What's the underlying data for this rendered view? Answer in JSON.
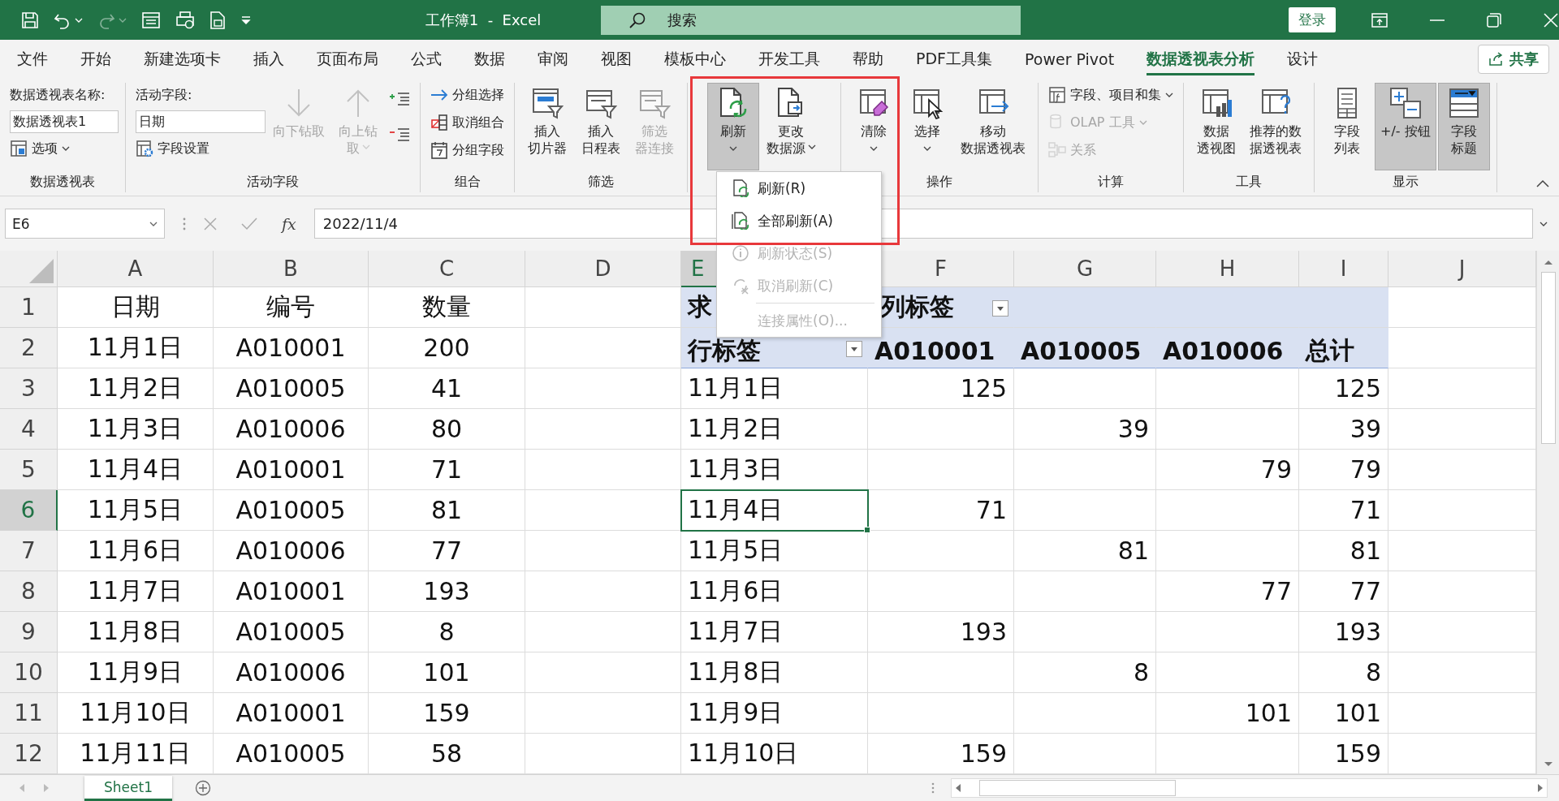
{
  "title_bar": {
    "title": "工作簿1  -  Excel",
    "search": {
      "placeholder": "搜索"
    },
    "login_button": "登录"
  },
  "tabs": [
    {
      "label": "文件",
      "selected": false
    },
    {
      "label": "开始",
      "selected": false
    },
    {
      "label": "新建选项卡",
      "selected": false
    },
    {
      "label": "插入",
      "selected": false
    },
    {
      "label": "页面布局",
      "selected": false
    },
    {
      "label": "公式",
      "selected": false
    },
    {
      "label": "数据",
      "selected": false
    },
    {
      "label": "审阅",
      "selected": false
    },
    {
      "label": "视图",
      "selected": false
    },
    {
      "label": "模板中心",
      "selected": false
    },
    {
      "label": "开发工具",
      "selected": false
    },
    {
      "label": "帮助",
      "selected": false
    },
    {
      "label": "PDF工具集",
      "selected": false
    },
    {
      "label": "Power Pivot",
      "selected": false
    },
    {
      "label": "数据透视表分析",
      "selected": true
    },
    {
      "label": "设计",
      "selected": false
    }
  ],
  "share_button": "共享",
  "ribbon": {
    "groups": [
      {
        "label": "数据透视表",
        "columns": [
          [
            {
              "kind": "field_label",
              "label": "数据透视表名称:"
            },
            {
              "kind": "text_field",
              "value": "数据透视表1"
            },
            {
              "kind": "small_button",
              "label": "选项",
              "disabled": false,
              "dropdown": true
            }
          ]
        ]
      },
      {
        "label": "活动字段",
        "columns": [
          [
            {
              "kind": "field_label",
              "label": "活动字段:"
            },
            {
              "kind": "text_field",
              "value": "日期"
            },
            {
              "kind": "small_button",
              "label": "字段设置",
              "disabled": false,
              "dropdown": false
            }
          ],
          [
            {
              "kind": "large_button",
              "lines": [
                "向下钻取"
              ],
              "disabled": true,
              "dropdown": false,
              "pressed": false
            }
          ],
          [
            {
              "kind": "large_button",
              "lines": [
                "向上钻",
                "取"
              ],
              "disabled": true,
              "dropdown": true,
              "pressed": false
            }
          ],
          [
            {
              "kind": "icon_button",
              "disabled": false
            },
            {
              "kind": "icon_button",
              "disabled": false
            }
          ]
        ]
      },
      {
        "label": "组合",
        "columns": [
          [
            {
              "kind": "small_button",
              "label": "分组选择",
              "disabled": false,
              "dropdown": false
            },
            {
              "kind": "small_button",
              "label": "取消组合",
              "disabled": false,
              "dropdown": false
            },
            {
              "kind": "small_button",
              "label": "分组字段",
              "disabled": false,
              "dropdown": false
            }
          ]
        ]
      },
      {
        "label": "筛选",
        "columns": [
          [
            {
              "kind": "large_button",
              "lines": [
                "插入",
                "切片器"
              ],
              "disabled": false,
              "dropdown": false,
              "pressed": false
            }
          ],
          [
            {
              "kind": "large_button",
              "lines": [
                "插入",
                "日程表"
              ],
              "disabled": false,
              "dropdown": false,
              "pressed": false
            }
          ],
          [
            {
              "kind": "large_button",
              "lines": [
                "筛选",
                "器连接"
              ],
              "disabled": true,
              "dropdown": false,
              "pressed": false
            }
          ]
        ]
      },
      {
        "columns": [
          [
            {
              "kind": "large_button",
              "lines": [
                "刷新"
              ],
              "disabled": false,
              "dropdown": true,
              "pressed": true
            }
          ],
          [
            {
              "kind": "large_button",
              "lines": [
                "更改",
                "数据源"
              ],
              "disabled": false,
              "dropdown": true,
              "pressed": false
            }
          ]
        ]
      },
      {
        "label": "操作",
        "columns": [
          [
            {
              "kind": "large_button",
              "lines": [
                "清除"
              ],
              "disabled": false,
              "dropdown": true,
              "pressed": false
            }
          ],
          [
            {
              "kind": "large_button",
              "lines": [
                "选择"
              ],
              "disabled": false,
              "dropdown": true,
              "pressed": false
            }
          ],
          [
            {
              "kind": "large_button",
              "lines": [
                "移动",
                "数据透视表"
              ],
              "disabled": false,
              "dropdown": false,
              "pressed": false
            }
          ]
        ]
      },
      {
        "label": "计算",
        "columns": [
          [
            {
              "kind": "small_button",
              "label": "字段、项目和集",
              "disabled": false,
              "dropdown": true
            },
            {
              "kind": "small_button",
              "label": "OLAP 工具",
              "disabled": true,
              "dropdown": true
            },
            {
              "kind": "small_button",
              "label": "关系",
              "disabled": true,
              "dropdown": false
            }
          ]
        ]
      },
      {
        "label": "工具",
        "columns": [
          [
            {
              "kind": "large_button",
              "lines": [
                "数据",
                "透视图"
              ],
              "disabled": false,
              "dropdown": false,
              "pressed": false
            }
          ],
          [
            {
              "kind": "large_button",
              "lines": [
                "推荐的数",
                "据透视表"
              ],
              "disabled": false,
              "dropdown": false,
              "pressed": false
            }
          ]
        ]
      },
      {
        "label": "显示",
        "columns": [
          [
            {
              "kind": "large_button",
              "lines": [
                "字段",
                "列表"
              ],
              "disabled": false,
              "dropdown": false,
              "pressed": false
            }
          ],
          [
            {
              "kind": "large_button",
              "lines": [
                "+/- 按钮"
              ],
              "disabled": false,
              "dropdown": false,
              "pressed": true
            }
          ],
          [
            {
              "kind": "large_button",
              "lines": [
                "字段",
                "标题"
              ],
              "disabled": false,
              "dropdown": false,
              "pressed": true
            }
          ]
        ]
      }
    ]
  },
  "dropdown_menu": {
    "items": [
      {
        "kind": "item",
        "label": "刷新(R)",
        "disabled": false
      },
      {
        "kind": "item",
        "label": "全部刷新(A)",
        "disabled": false
      },
      {
        "kind": "item",
        "label": "刷新状态(S)",
        "disabled": true
      },
      {
        "kind": "item",
        "label": "取消刷新(C)",
        "disabled": true
      },
      {
        "kind": "separator"
      },
      {
        "kind": "item",
        "label": "连接属性(O)...",
        "disabled": true
      }
    ]
  },
  "formula_bar": {
    "name_box": "E6",
    "function_label": "fx",
    "value": "2022/11/4"
  },
  "sheet": {
    "columns": [
      {
        "label": "A",
        "selected": false
      },
      {
        "label": "B",
        "selected": false
      },
      {
        "label": "C",
        "selected": false
      },
      {
        "label": "D",
        "selected": false
      },
      {
        "label": "E",
        "selected": true
      },
      {
        "label": "F",
        "selected": false
      },
      {
        "label": "G",
        "selected": false
      },
      {
        "label": "H",
        "selected": false
      },
      {
        "label": "I",
        "selected": false
      },
      {
        "label": "J",
        "selected": false
      }
    ],
    "rows": [
      {
        "header": "1",
        "selected": false,
        "pivot_header": true,
        "cells": [
          "日期",
          "编号",
          "数量",
          "",
          "求",
          "列标签"
        ],
        "filters": [
          false,
          false,
          false,
          false,
          false,
          true
        ]
      },
      {
        "header": "2",
        "selected": false,
        "pivot_header": true,
        "cells": [
          "11月1日",
          "A010001",
          "200",
          "",
          "行标签",
          "A010001",
          "A010005",
          "A010006",
          "总计"
        ],
        "filters": [
          false,
          false,
          false,
          false,
          true,
          false,
          false,
          false,
          false
        ]
      },
      {
        "header": "3",
        "selected": false,
        "pivot_header": false,
        "cells": [
          "11月2日",
          "A010005",
          "41",
          "",
          "11月1日",
          "125",
          "",
          "",
          "125"
        ]
      },
      {
        "header": "4",
        "selected": false,
        "pivot_header": false,
        "cells": [
          "11月3日",
          "A010006",
          "80",
          "",
          "11月2日",
          "",
          "39",
          "",
          "39"
        ]
      },
      {
        "header": "5",
        "selected": false,
        "pivot_header": false,
        "cells": [
          "11月4日",
          "A010001",
          "71",
          "",
          "11月3日",
          "",
          "",
          "79",
          "79"
        ]
      },
      {
        "header": "6",
        "selected": true,
        "pivot_header": false,
        "cells": [
          "11月5日",
          "A010005",
          "81",
          "",
          "11月4日",
          "71",
          "",
          "",
          "71"
        ]
      },
      {
        "header": "7",
        "selected": false,
        "pivot_header": false,
        "cells": [
          "11月6日",
          "A010006",
          "77",
          "",
          "11月5日",
          "",
          "81",
          "",
          "81"
        ]
      },
      {
        "header": "8",
        "selected": false,
        "pivot_header": false,
        "cells": [
          "11月7日",
          "A010001",
          "193",
          "",
          "11月6日",
          "",
          "",
          "77",
          "77"
        ]
      },
      {
        "header": "9",
        "selected": false,
        "pivot_header": false,
        "cells": [
          "11月8日",
          "A010005",
          "8",
          "",
          "11月7日",
          "193",
          "",
          "",
          "193"
        ]
      },
      {
        "header": "10",
        "selected": false,
        "pivot_header": false,
        "cells": [
          "11月9日",
          "A010006",
          "101",
          "",
          "11月8日",
          "",
          "8",
          "",
          "8"
        ]
      },
      {
        "header": "11",
        "selected": false,
        "pivot_header": false,
        "cells": [
          "11月10日",
          "A010001",
          "159",
          "",
          "11月9日",
          "",
          "",
          "101",
          "101"
        ]
      },
      {
        "header": "12",
        "selected": false,
        "pivot_header": false,
        "cells": [
          "11月11日",
          "A010005",
          "58",
          "",
          "11月10日",
          "159",
          "",
          "",
          "159"
        ]
      }
    ]
  },
  "sheet_tabs": [
    {
      "label": "Sheet1",
      "selected": true
    }
  ]
}
